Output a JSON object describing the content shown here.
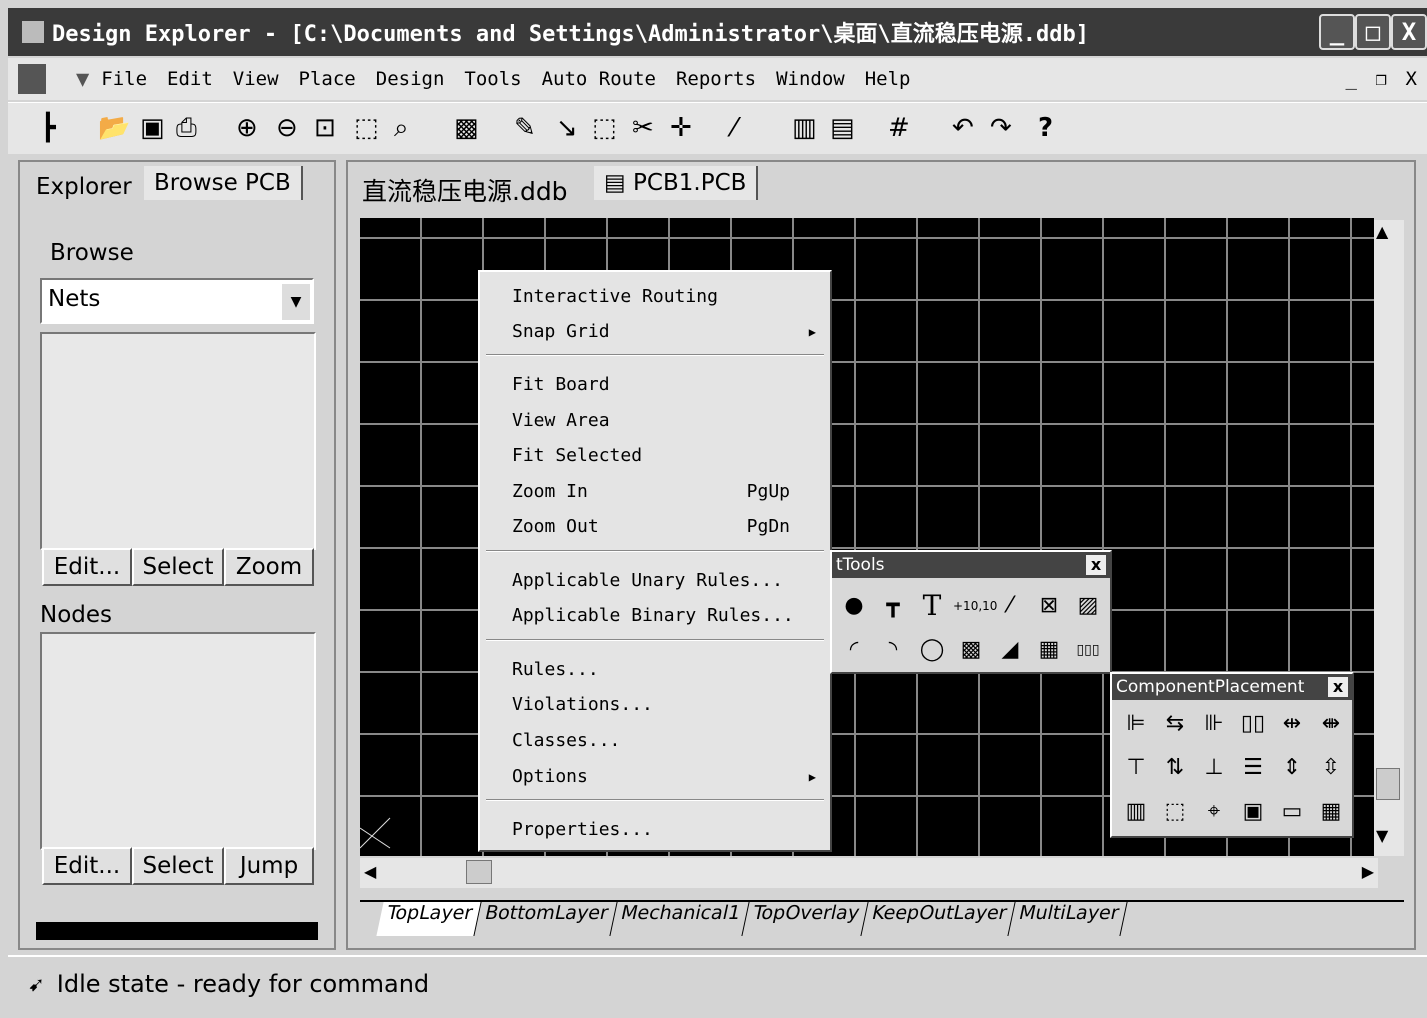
{
  "window": {
    "title": "Design Explorer - [C:\\Documents and Settings\\Administrator\\桌面\\直流稳压电源.ddb]",
    "min": "_",
    "max": "□",
    "close": "X"
  },
  "menubar": {
    "items": [
      "File",
      "Edit",
      "View",
      "Place",
      "Design",
      "Tools",
      "Auto Route",
      "Reports",
      "Window",
      "Help"
    ],
    "doc_min": "_",
    "doc_restore": "❐",
    "doc_close": "X"
  },
  "toolbar": {
    "icons": [
      "design-manager",
      "open",
      "save",
      "print",
      "zoom-in",
      "zoom-out",
      "zoom-area",
      "zoom-select",
      "zoom-last",
      "3d-view",
      "cross-probe",
      "interactive-route",
      "select-area",
      "deselect",
      "move",
      "autoroute",
      "library",
      "browse-library",
      "grid",
      "undo",
      "redo",
      "help"
    ]
  },
  "left_panel": {
    "tabs": [
      "Explorer",
      "Browse PCB"
    ],
    "browse_label": "Browse",
    "browse_value": "Nets",
    "buttons_top": [
      "Edit...",
      "Select",
      "Zoom"
    ],
    "nodes_label": "Nodes",
    "buttons_bottom": [
      "Edit...",
      "Select",
      "Jump"
    ]
  },
  "doc_tabs": [
    "直流稳压电源.ddb",
    "PCB1.PCB"
  ],
  "context_menu": {
    "items": [
      {
        "label": "Interactive Routing"
      },
      {
        "label": "Snap Grid",
        "submenu": true
      },
      {
        "label": "Fit Board"
      },
      {
        "label": "View Area"
      },
      {
        "label": "Fit Selected"
      },
      {
        "label": "Zoom In",
        "shortcut": "PgUp"
      },
      {
        "label": "Zoom Out",
        "shortcut": "PgDn"
      },
      {
        "label": "Applicable Unary Rules..."
      },
      {
        "label": "Applicable Binary Rules..."
      },
      {
        "label": "Rules..."
      },
      {
        "label": "Violations..."
      },
      {
        "label": "Classes..."
      },
      {
        "label": "Options",
        "submenu": true
      },
      {
        "label": "Properties..."
      }
    ]
  },
  "placement_tools": {
    "title": "tTools",
    "close": "x"
  },
  "component_placement": {
    "title": "ComponentPlacement",
    "close": "x"
  },
  "layer_tabs": [
    "TopLayer",
    "BottomLayer",
    "Mechanical1",
    "TopOverlay",
    "KeepOutLayer",
    "MultiLayer"
  ],
  "status": {
    "text": "Idle state - ready for command"
  }
}
